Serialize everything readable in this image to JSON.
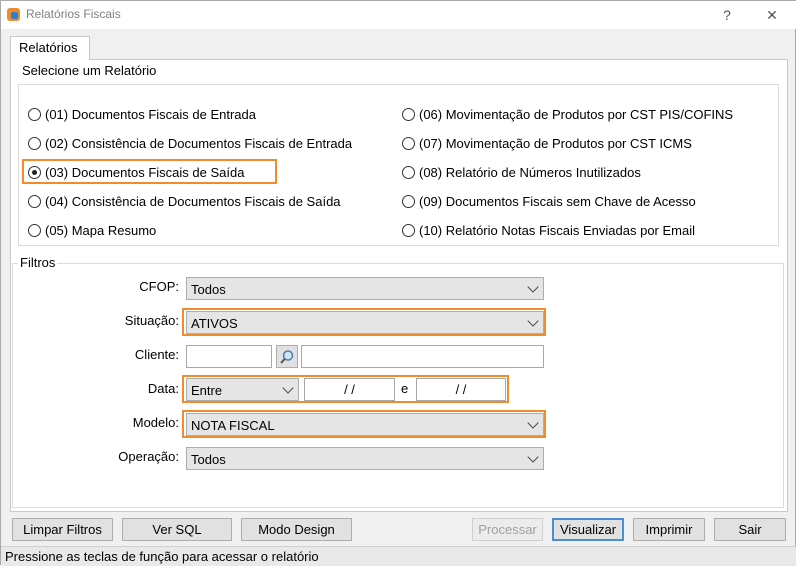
{
  "window": {
    "title": "Relatórios Fiscais",
    "help": "?",
    "close": "✕"
  },
  "tab": {
    "label": "Relatórios"
  },
  "select_group": {
    "title": "Selecione um Relatório",
    "options": [
      {
        "label": "(01) Documentos Fiscais de Entrada",
        "checked": false
      },
      {
        "label": "(02) Consistência de Documentos Fiscais de Entrada",
        "checked": false
      },
      {
        "label": "(03) Documentos Fiscais de Saída",
        "checked": true
      },
      {
        "label": "(04) Consistência de Documentos Fiscais de Saída",
        "checked": false
      },
      {
        "label": "(05) Mapa Resumo",
        "checked": false
      },
      {
        "label": "(06) Movimentação de Produtos por CST PIS/COFINS",
        "checked": false
      },
      {
        "label": "(07) Movimentação de Produtos por CST ICMS",
        "checked": false
      },
      {
        "label": "(08) Relatório de Números Inutilizados",
        "checked": false
      },
      {
        "label": "(09) Documentos Fiscais sem Chave de Acesso",
        "checked": false
      },
      {
        "label": "(10) Relatório Notas Fiscais Enviadas por Email",
        "checked": false
      }
    ]
  },
  "filters": {
    "title": "Filtros",
    "cfop": {
      "label": "CFOP:",
      "value": "Todos"
    },
    "situacao": {
      "label": "Situação:",
      "value": "ATIVOS"
    },
    "cliente": {
      "label": "Cliente:",
      "code": "",
      "name": ""
    },
    "data": {
      "label": "Data:",
      "mode": "Entre",
      "from": "/ /",
      "sep": "e",
      "to": "/ /"
    },
    "modelo": {
      "label": "Modelo:",
      "value": "NOTA FISCAL"
    },
    "operacao": {
      "label": "Operação:",
      "value": "Todos"
    }
  },
  "buttons": {
    "limpar": "Limpar Filtros",
    "sql": "Ver SQL",
    "design": "Modo Design",
    "processar": "Processar",
    "visualizar": "Visualizar",
    "imprimir": "Imprimir",
    "sair": "Sair"
  },
  "status": {
    "text": "Pressione as teclas de função para acessar o relatório"
  },
  "colors": {
    "highlight": "#f28a2e",
    "accent": "#4a8fd6"
  }
}
